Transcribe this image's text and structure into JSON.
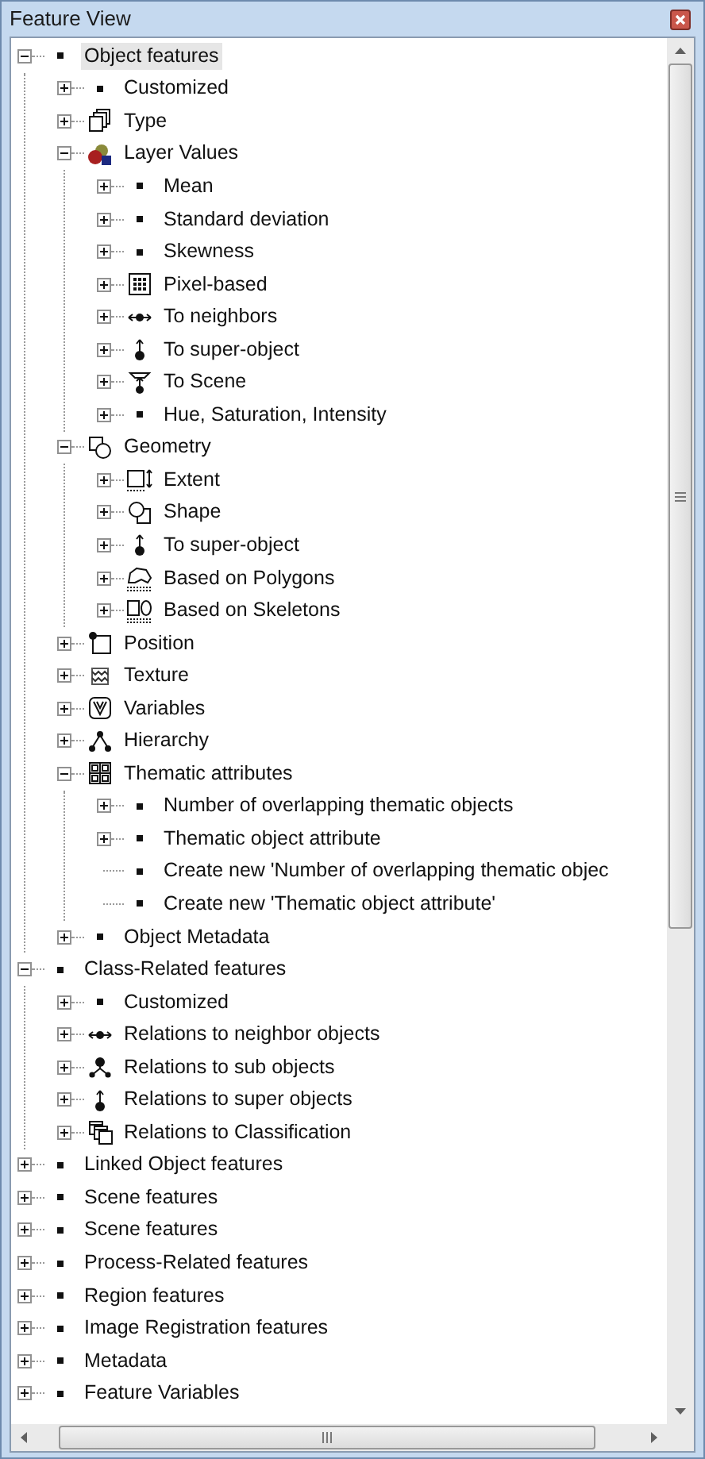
{
  "window": {
    "title": "Feature View"
  },
  "tree": [
    {
      "label": "Object features",
      "kind": "bullet",
      "expanded": true,
      "selected": true,
      "children": [
        {
          "label": "Customized",
          "kind": "bullet",
          "expanded": false,
          "selected": false
        },
        {
          "label": "Type",
          "kind": "type",
          "expanded": false,
          "selected": false
        },
        {
          "label": "Layer Values",
          "kind": "layer",
          "expanded": true,
          "selected": false,
          "children": [
            {
              "label": "Mean",
              "kind": "bullet",
              "expanded": false,
              "selected": false
            },
            {
              "label": "Standard deviation",
              "kind": "bullet",
              "expanded": false,
              "selected": false
            },
            {
              "label": "Skewness",
              "kind": "bullet",
              "expanded": false,
              "selected": false
            },
            {
              "label": "Pixel-based",
              "kind": "pixel",
              "expanded": false,
              "selected": false
            },
            {
              "label": "To neighbors",
              "kind": "neighbors",
              "expanded": false,
              "selected": false
            },
            {
              "label": "To super-object",
              "kind": "super",
              "expanded": false,
              "selected": false
            },
            {
              "label": "To Scene",
              "kind": "scene",
              "expanded": false,
              "selected": false
            },
            {
              "label": "Hue, Saturation, Intensity",
              "kind": "bullet",
              "expanded": false,
              "selected": false
            }
          ]
        },
        {
          "label": "Geometry",
          "kind": "geometry",
          "expanded": true,
          "selected": false,
          "children": [
            {
              "label": "Extent",
              "kind": "extent",
              "expanded": false,
              "selected": false
            },
            {
              "label": "Shape",
              "kind": "shape",
              "expanded": false,
              "selected": false
            },
            {
              "label": "To super-object",
              "kind": "super",
              "expanded": false,
              "selected": false
            },
            {
              "label": "Based on Polygons",
              "kind": "polygons",
              "expanded": false,
              "selected": false
            },
            {
              "label": "Based on Skeletons",
              "kind": "skeletons",
              "expanded": false,
              "selected": false
            }
          ]
        },
        {
          "label": "Position",
          "kind": "position",
          "expanded": false,
          "selected": false
        },
        {
          "label": "Texture",
          "kind": "texture",
          "expanded": false,
          "selected": false
        },
        {
          "label": "Variables",
          "kind": "variables",
          "expanded": false,
          "selected": false
        },
        {
          "label": "Hierarchy",
          "kind": "hierarchy",
          "expanded": false,
          "selected": false
        },
        {
          "label": "Thematic attributes",
          "kind": "thematic",
          "expanded": true,
          "selected": false,
          "children": [
            {
              "label": "Number of overlapping thematic objects",
              "kind": "bullet",
              "expanded": false,
              "selected": false
            },
            {
              "label": "Thematic object attribute",
              "kind": "bullet",
              "expanded": false,
              "selected": false
            },
            {
              "label": "Create new 'Number of overlapping thematic objec",
              "kind": "bullet",
              "selected": false
            },
            {
              "label": "Create new 'Thematic object attribute'",
              "kind": "bullet",
              "selected": false
            }
          ]
        },
        {
          "label": "Object Metadata",
          "kind": "bullet",
          "expanded": false,
          "selected": false
        }
      ]
    },
    {
      "label": "Class-Related features",
      "kind": "bullet",
      "expanded": true,
      "selected": false,
      "children": [
        {
          "label": "Customized",
          "kind": "bullet",
          "expanded": false,
          "selected": false
        },
        {
          "label": "Relations to neighbor objects",
          "kind": "neighbors",
          "expanded": false,
          "selected": false
        },
        {
          "label": "Relations to sub objects",
          "kind": "sub",
          "expanded": false,
          "selected": false
        },
        {
          "label": "Relations to super objects",
          "kind": "super",
          "expanded": false,
          "selected": false
        },
        {
          "label": "Relations to Classification",
          "kind": "classification",
          "expanded": false,
          "selected": false
        }
      ]
    },
    {
      "label": "Linked Object features",
      "kind": "bullet",
      "expanded": false,
      "selected": false
    },
    {
      "label": "Scene features",
      "kind": "bullet",
      "expanded": false,
      "selected": false
    },
    {
      "label": "Scene features",
      "kind": "bullet",
      "expanded": false,
      "selected": false
    },
    {
      "label": "Process-Related features",
      "kind": "bullet",
      "expanded": false,
      "selected": false
    },
    {
      "label": "Region features",
      "kind": "bullet",
      "expanded": false,
      "selected": false
    },
    {
      "label": "Image Registration features",
      "kind": "bullet",
      "expanded": false,
      "selected": false
    },
    {
      "label": "Metadata",
      "kind": "bullet",
      "expanded": false,
      "selected": false
    },
    {
      "label": "Feature Variables",
      "kind": "bullet",
      "expanded": false,
      "selected": false
    }
  ]
}
